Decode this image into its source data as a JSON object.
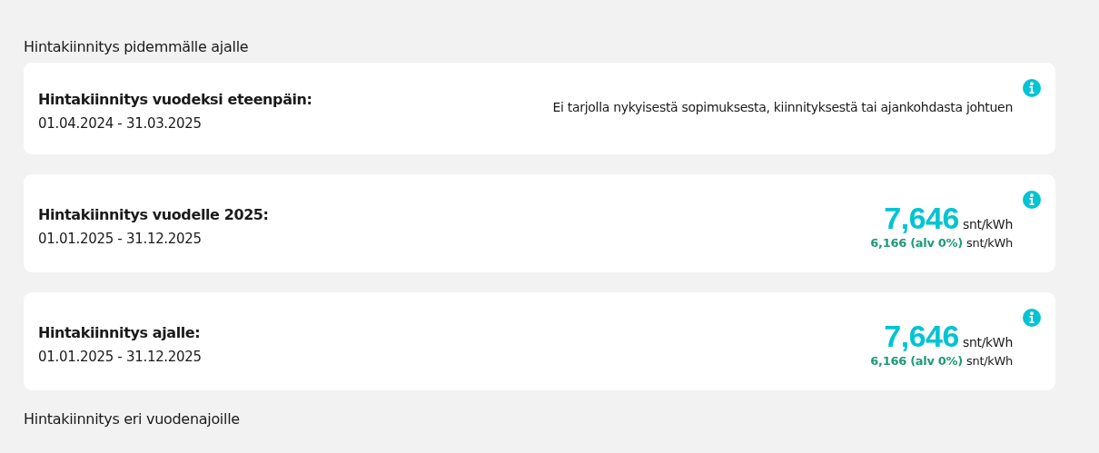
{
  "sections": [
    {
      "heading": "Hintakiinnitys pidemmälle ajalle",
      "cards": [
        {
          "kind": "unavailable",
          "title": "Hintakiinnitys vuodeksi eteenpäin:",
          "period": "01.04.2024 - 31.03.2025",
          "note": "Ei tarjolla nykyisestä sopimuksesta, kiinnityksestä tai ajankohdasta johtuen"
        },
        {
          "kind": "price",
          "title": "Hintakiinnitys vuodelle 2025:",
          "period": "01.01.2025 - 31.12.2025",
          "price": "7,646",
          "unit": "snt/kWh",
          "vat_free_price": "6,166 (alv 0%)",
          "vat_free_unit": "snt/kWh"
        },
        {
          "kind": "price",
          "title": "Hintakiinnitys ajalle:",
          "period": "01.01.2025 - 31.12.2025",
          "price": "7,646",
          "unit": "snt/kWh",
          "vat_free_price": "6,166 (alv 0%)",
          "vat_free_unit": "snt/kWh"
        }
      ]
    },
    {
      "heading": "Hintakiinnitys eri vuodenajoille"
    }
  ]
}
